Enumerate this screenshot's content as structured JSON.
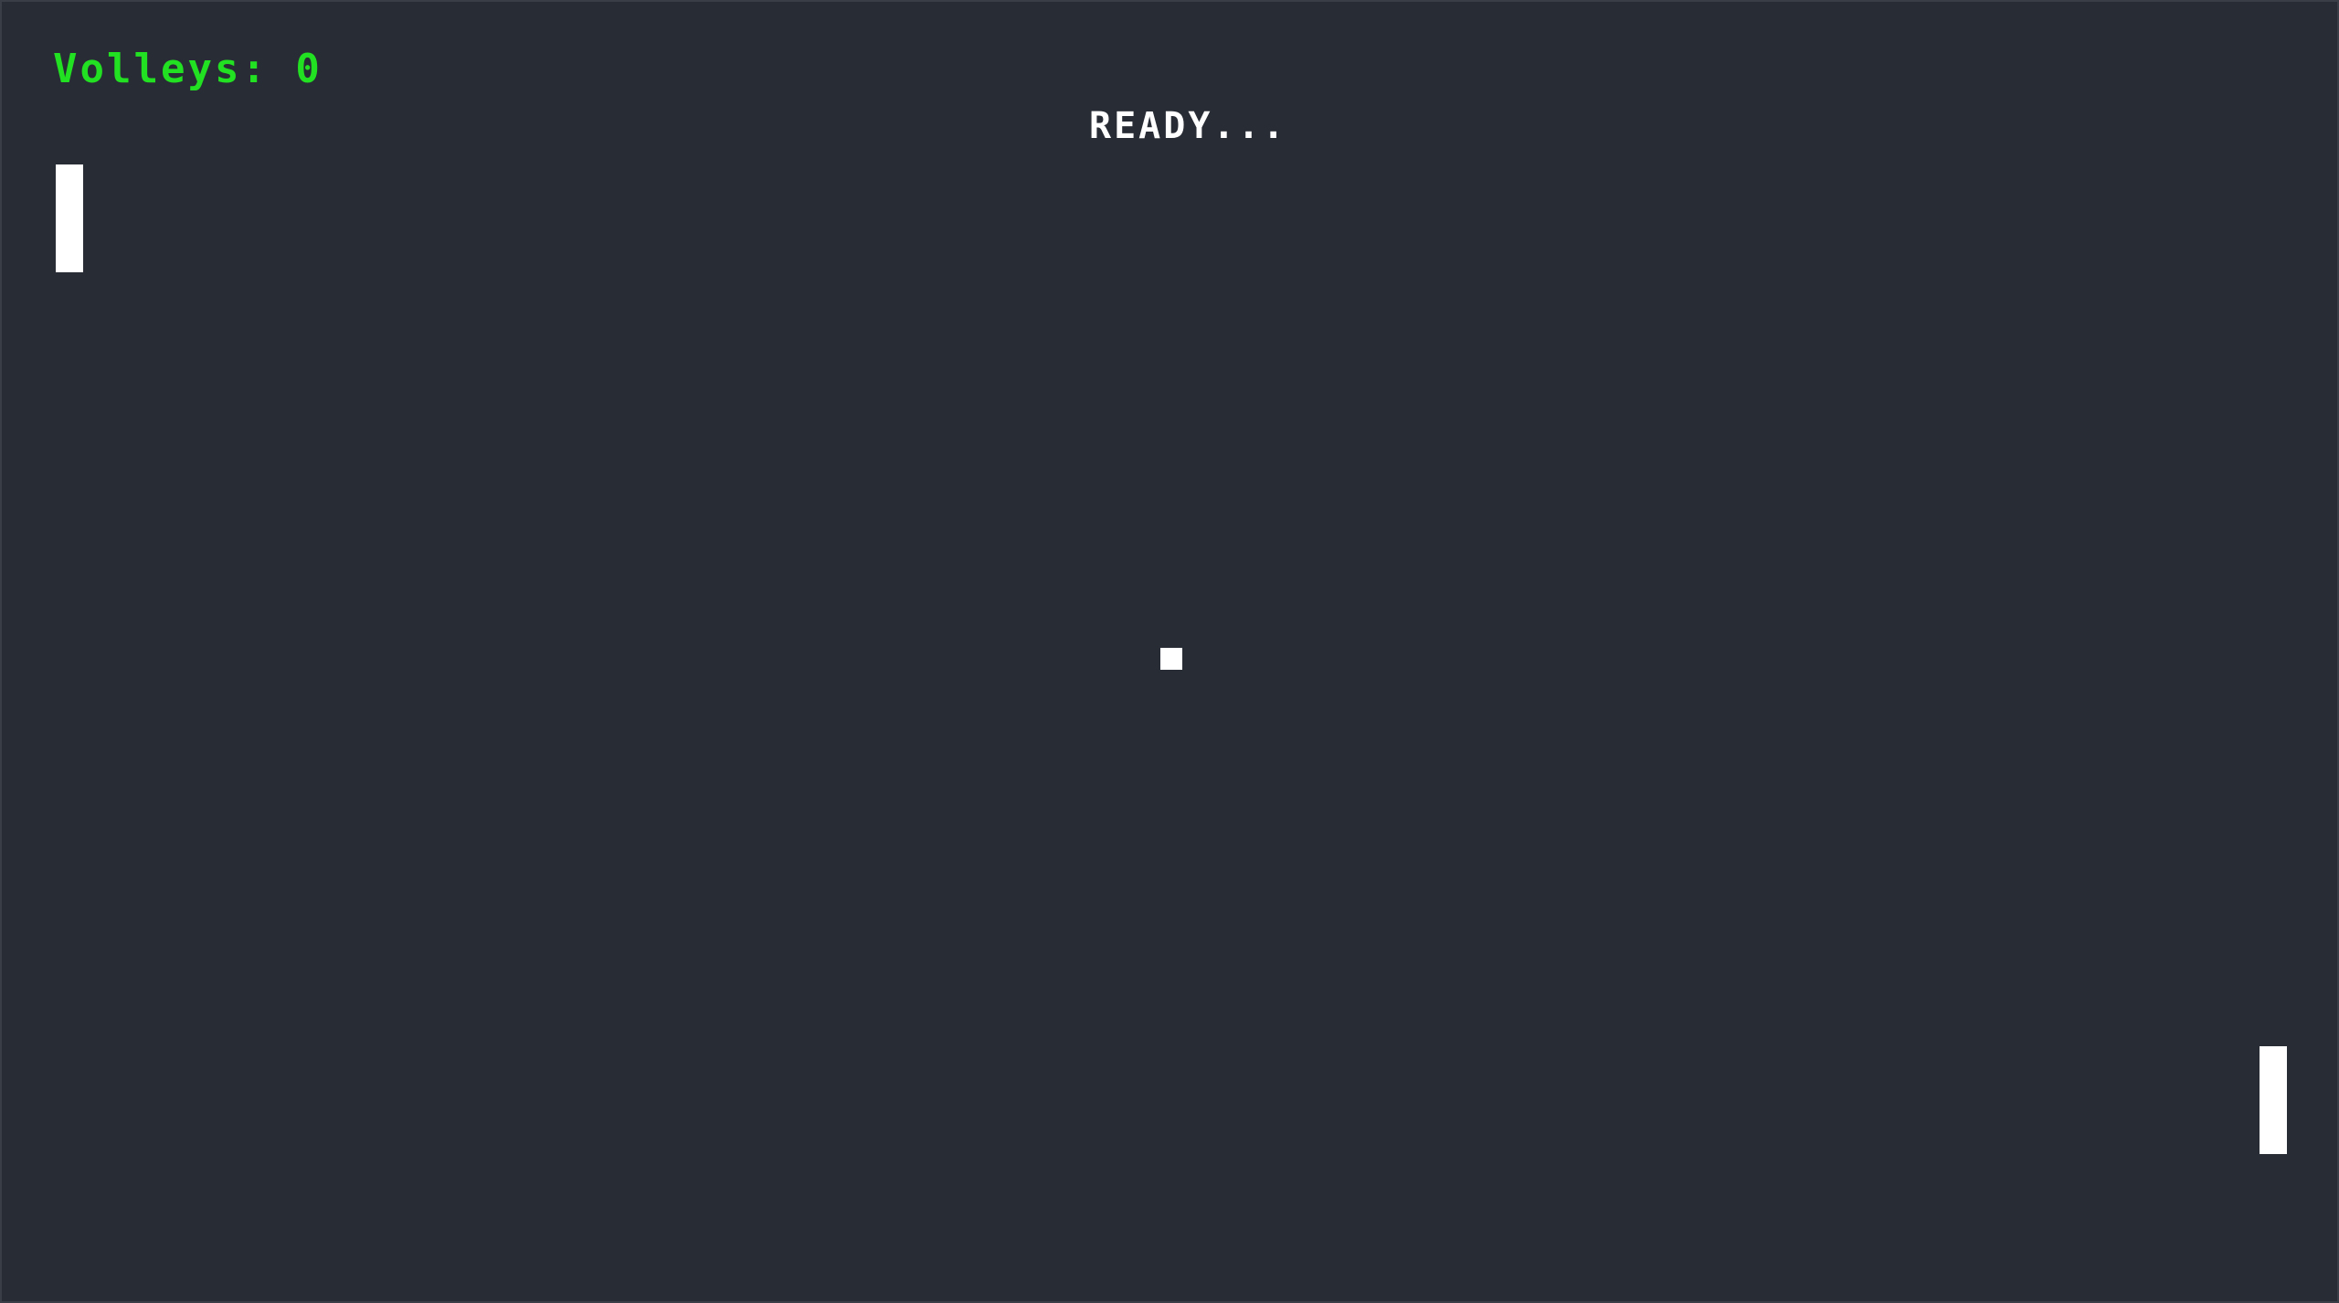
{
  "hud": {
    "score_text": "Volleys: 0",
    "score_color": "#22e022"
  },
  "status": {
    "message": "READY..."
  },
  "colors": {
    "background": "#282c34",
    "paddle": "#ffffff",
    "ball": "#ffffff"
  }
}
